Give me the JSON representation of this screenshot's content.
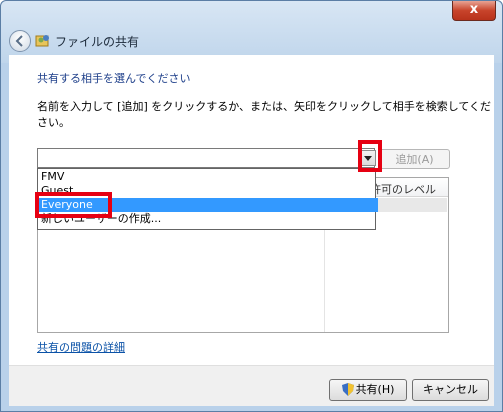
{
  "window": {
    "title": "ファイルの共有",
    "close_glyph": "x"
  },
  "content": {
    "heading": "共有する相手を選んでください",
    "instruction": "名前を入力して [追加] をクリックするか、または、矢印をクリックして相手を検索してください。",
    "combo_value": "",
    "add_button": "追加(A)",
    "list_header_permission": "許可のレベル",
    "dropdown_items": [
      "FMV",
      "Guest",
      "Everyone",
      "新しいユーザーの作成..."
    ],
    "selected_item": "Everyone",
    "help_link": "共有の問題の詳細"
  },
  "footer": {
    "share_button": "共有(H)",
    "cancel_button": "キャンセル"
  },
  "colors": {
    "annotation_red": "#e60012",
    "selection_blue": "#3399ff",
    "heading_blue": "#1e3f8a"
  }
}
